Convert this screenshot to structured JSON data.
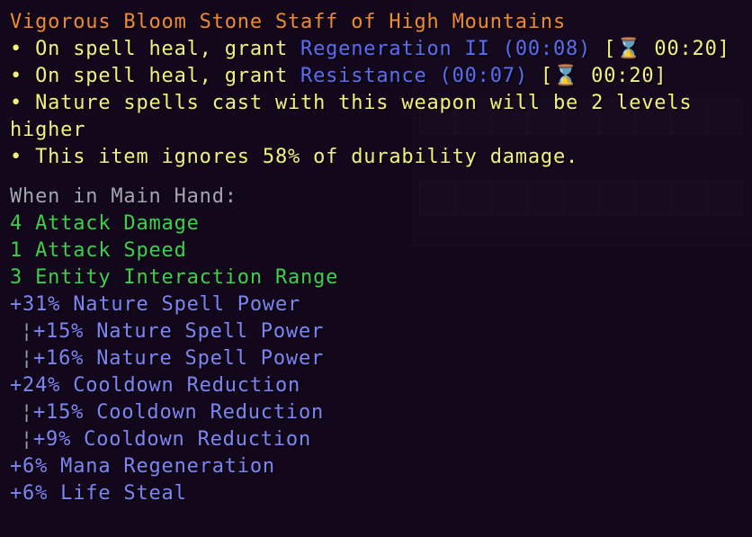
{
  "item": {
    "name": "Vigorous Bloom Stone Staff of High Mountains",
    "effects": [
      {
        "prefix": "• On spell heal, grant ",
        "effect": "Regeneration II (00:08)",
        "suffix": " [⌛ 00:20]"
      },
      {
        "prefix": "• On spell heal, grant ",
        "effect": "Resistance (00:07)",
        "suffix": " [⌛ 00:20]"
      }
    ],
    "nature_line_1": "• Nature spells cast with this weapon will be 2 levels",
    "nature_line_2": "higher",
    "durability_line": "• This item ignores 58% of durability damage.",
    "main_hand_header": "When in Main Hand:",
    "base_stats": [
      " 4 Attack Damage",
      " 1 Attack Speed",
      " 3 Entity Interaction Range"
    ],
    "attributes": {
      "nature_total": "+31% Nature Spell Power",
      "nature_sub1": "+15% Nature Spell Power",
      "nature_sub2": "+16% Nature Spell Power",
      "cooldown_total": "+24% Cooldown Reduction",
      "cooldown_sub1": "+15% Cooldown Reduction",
      "cooldown_sub2": "+9% Cooldown Reduction",
      "mana_regen": "+6% Mana Regeneration",
      "life_steal": "+6% Life Steal"
    },
    "sub_bar": "¦"
  },
  "colors": {
    "title": "#f08a2a",
    "description": "#f3f07a",
    "effect": "#5a6cf0",
    "header": "#a4a4b4",
    "base_stat": "#38d24a",
    "attribute": "#7d84f4"
  }
}
